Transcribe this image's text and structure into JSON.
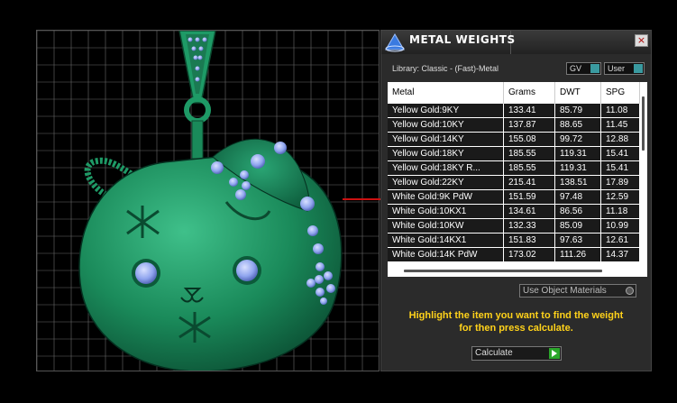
{
  "panel": {
    "title": "METAL WEIGHTS",
    "close_label": "×",
    "library_label": "Library: Classic - (Fast)-Metal",
    "gv_label": "GV",
    "user_label": "User",
    "use_object_materials_label": "Use Object Materials",
    "hint_line1": "Highlight the item you want to find the weight",
    "hint_line2": "for then press calculate.",
    "calculate_label": "Calculate"
  },
  "table": {
    "columns": [
      "Metal",
      "Grams",
      "DWT",
      "SPG"
    ],
    "rows": [
      [
        "Yellow Gold:9KY",
        "133.41",
        "85.79",
        "11.08"
      ],
      [
        "Yellow Gold:10KY",
        "137.87",
        "88.65",
        "11.45"
      ],
      [
        "Yellow Gold:14KY",
        "155.08",
        "99.72",
        "12.88"
      ],
      [
        "Yellow Gold:18KY",
        "185.55",
        "119.31",
        "15.41"
      ],
      [
        "Yellow Gold:18KY R...",
        "185.55",
        "119.31",
        "15.41"
      ],
      [
        "Yellow Gold:22KY",
        "215.41",
        "138.51",
        "17.89"
      ],
      [
        "White Gold:9K PdW",
        "151.59",
        "97.48",
        "12.59"
      ],
      [
        "White Gold:10KX1",
        "134.61",
        "86.56",
        "11.18"
      ],
      [
        "White Gold:10KW",
        "132.33",
        "85.09",
        "10.99"
      ],
      [
        "White Gold:14KX1",
        "151.83",
        "97.63",
        "12.61"
      ],
      [
        "White Gold:14K PdW",
        "173.02",
        "111.26",
        "14.37"
      ]
    ]
  },
  "colors": {
    "model_green": "#1e8a5e",
    "gem_blue": "#8fa4ee",
    "hint_yellow": "#ffd21a",
    "axis_red": "#cc1111"
  }
}
